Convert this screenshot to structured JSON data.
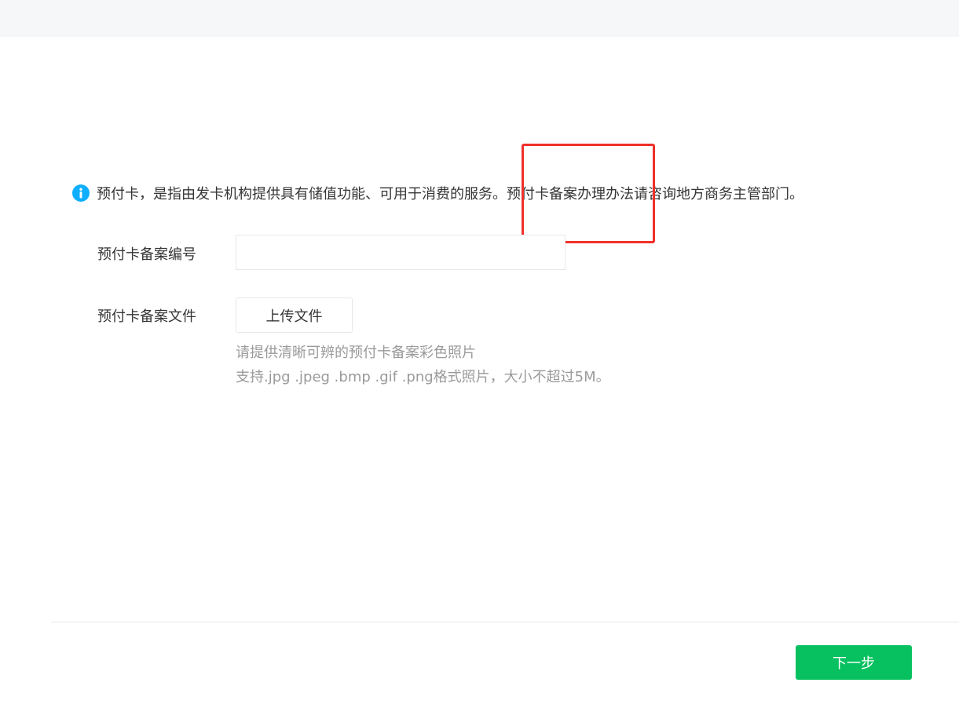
{
  "notice": {
    "icon": "info-icon",
    "icon_color": "#10aeff",
    "text": "预付卡，是指由发卡机构提供具有储值功能、可用于消费的服务。预付卡备案办理办法请咨询地方商务主管部门。"
  },
  "form": {
    "record_number": {
      "label": "预付卡备案编号",
      "value": "",
      "placeholder": ""
    },
    "record_file": {
      "label": "预付卡备案文件",
      "upload_label": "上传文件",
      "hint_line_1": "请提供清晰可辨的预付卡备案彩色照片",
      "hint_line_2": "支持.jpg .jpeg .bmp .gif .png格式照片，大小不超过5M。"
    }
  },
  "footer": {
    "next_label": "下一步"
  },
  "colors": {
    "primary": "#07c160",
    "annotation": "#f0302a",
    "hint": "#9a9a9a"
  }
}
